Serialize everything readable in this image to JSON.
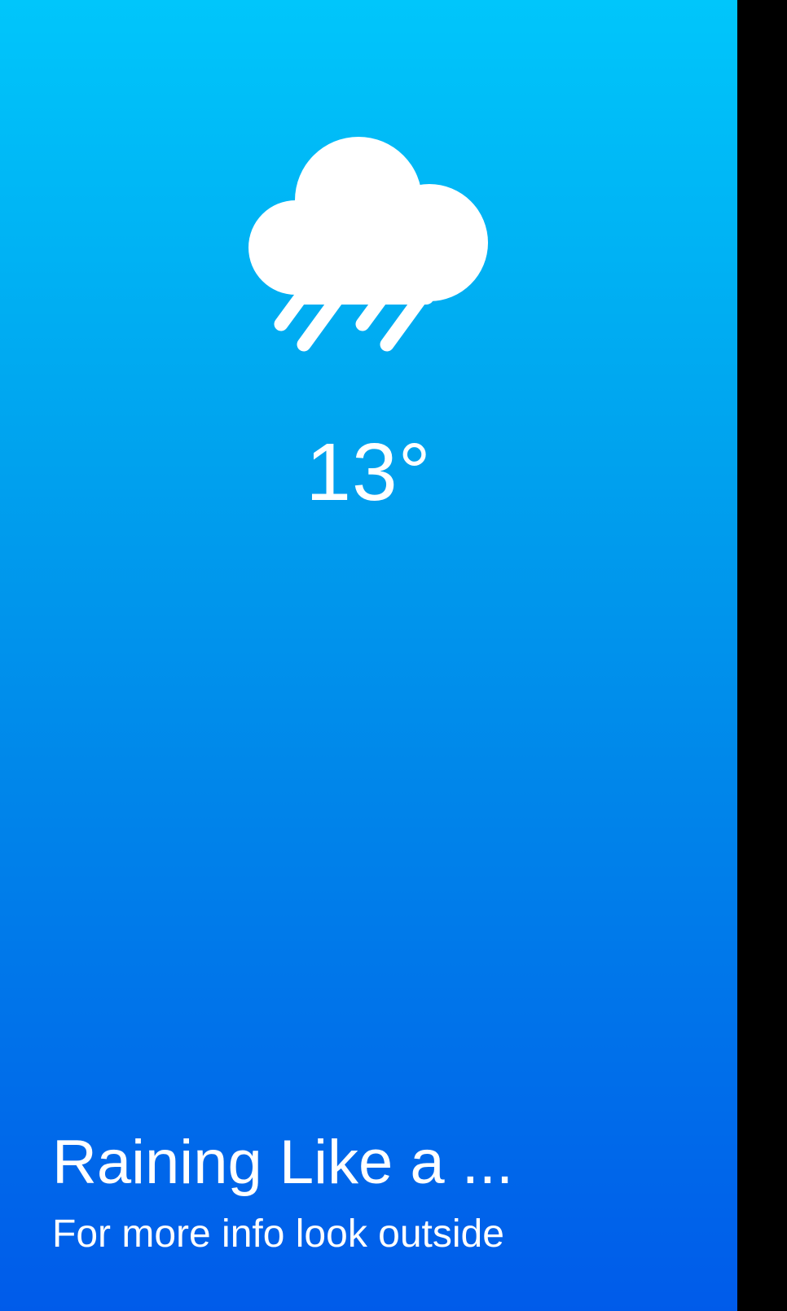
{
  "weather": {
    "icon": "rain-cloud-icon",
    "temperature": "13°"
  },
  "footer": {
    "title": "Raining Like a ...",
    "subtitle": "For more info look outside"
  },
  "colors": {
    "gradient_top": "#00c6fb",
    "gradient_bottom": "#005bea",
    "text": "#ffffff"
  }
}
